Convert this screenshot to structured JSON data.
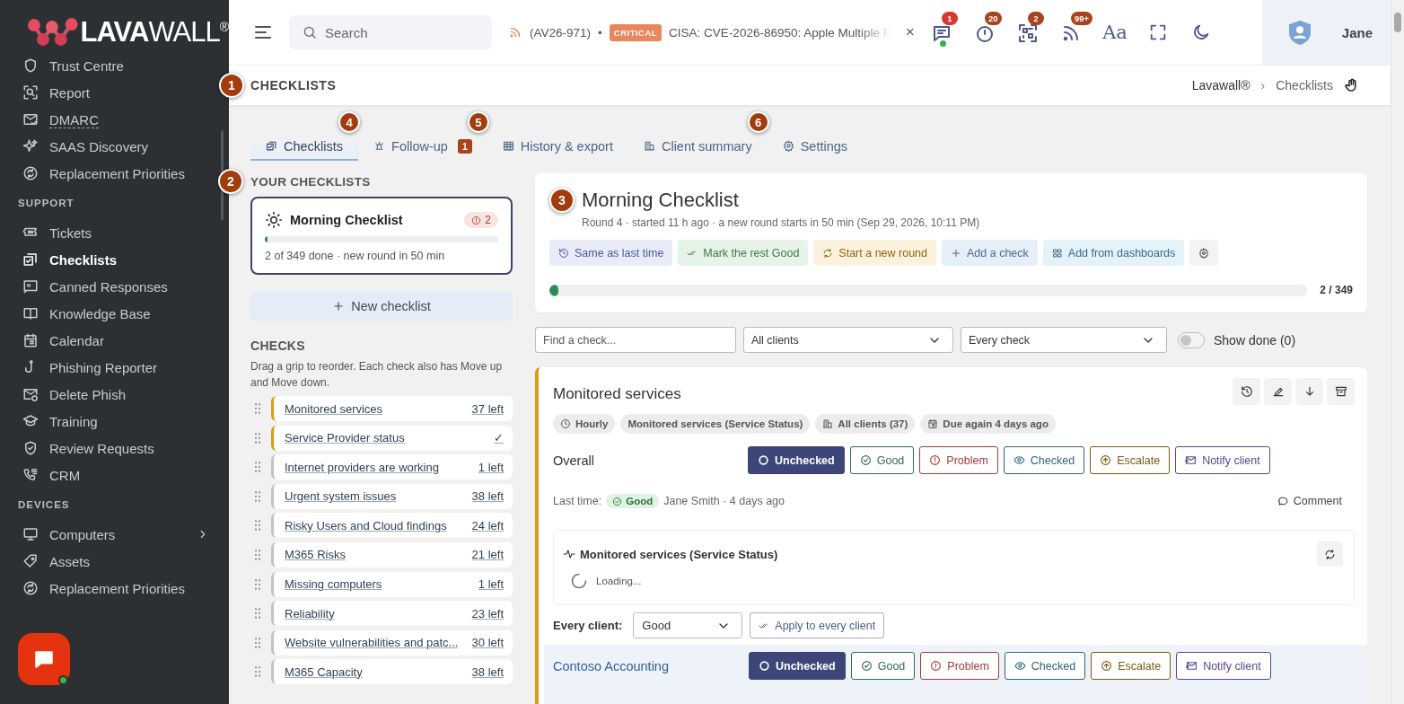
{
  "sidebar": {
    "logo_bold": "LAVA",
    "logo_light": "WALL",
    "logo_mark": "®",
    "items": [
      {
        "kind": "link",
        "label": "Trust Centre",
        "selected": false
      },
      {
        "kind": "link",
        "label": "Report",
        "selected": false
      },
      {
        "kind": "link",
        "label": "DMARC",
        "selected": false,
        "underlined": true
      },
      {
        "kind": "link",
        "label": "SAAS Discovery",
        "selected": false
      },
      {
        "kind": "link",
        "label": "Replacement Priorities",
        "selected": false
      },
      {
        "kind": "section",
        "label": "SUPPORT"
      },
      {
        "kind": "link",
        "label": "Tickets",
        "selected": false
      },
      {
        "kind": "link",
        "label": "Checklists",
        "selected": true
      },
      {
        "kind": "link",
        "label": "Canned Responses",
        "selected": false
      },
      {
        "kind": "link",
        "label": "Knowledge Base",
        "selected": false
      },
      {
        "kind": "link",
        "label": "Calendar",
        "selected": false
      },
      {
        "kind": "link",
        "label": "Phishing Reporter",
        "selected": false
      },
      {
        "kind": "link",
        "label": "Delete Phish",
        "selected": false
      },
      {
        "kind": "link",
        "label": "Training",
        "selected": false
      },
      {
        "kind": "link",
        "label": "Review Requests",
        "selected": false
      },
      {
        "kind": "link",
        "label": "CRM",
        "selected": false
      },
      {
        "kind": "section",
        "label": "DEVICES"
      },
      {
        "kind": "link",
        "label": "Computers",
        "selected": false,
        "expandable": true
      },
      {
        "kind": "link",
        "label": "Assets",
        "selected": false
      },
      {
        "kind": "link",
        "label": "Replacement Priorities",
        "selected": false
      }
    ],
    "chat": {
      "online": true
    }
  },
  "topbar": {
    "search": {
      "placeholder": "Search"
    },
    "ticker": {
      "prefix": "(AV26-971)",
      "separator": "•",
      "severity": "CRITICAL",
      "headline": "CISA: CVE-2026-86950: Apple Multiple P",
      "close": "×"
    },
    "notifications": [
      {
        "kind": "chat",
        "count": "1",
        "color": "#d63a2f",
        "online": true
      },
      {
        "kind": "timer",
        "count": "20",
        "color": "#a8431c"
      },
      {
        "kind": "qr",
        "count": "2",
        "color": "#a8431c"
      },
      {
        "kind": "feed",
        "count": "99+",
        "color": "#a8431c"
      }
    ],
    "font_button": "Aa",
    "user": "Jane"
  },
  "page_header": {
    "callout": "1",
    "title": "CHECKLISTS",
    "breadcrumb": [
      "Lavawall®",
      "Checklists"
    ],
    "breadcrumb_separator": "›"
  },
  "tabs": [
    {
      "label": "Checklists",
      "selected": true
    },
    {
      "label": "Follow-up",
      "selected": false,
      "badge": "1",
      "callout": "4"
    },
    {
      "label": "History & export",
      "selected": false,
      "callout": "5"
    },
    {
      "label": "Client summary",
      "selected": false
    },
    {
      "label": "Settings",
      "selected": false,
      "callout": "6"
    }
  ],
  "your_checklists": {
    "callout": "2",
    "heading": "YOUR CHECKLISTS",
    "items": [
      {
        "title": "Morning Checklist",
        "alerts": "2",
        "level": 0.006,
        "summary": "2 of 349 done · new round in 50 min",
        "selected": true
      }
    ],
    "new_button": "New checklist"
  },
  "checks": {
    "heading": "CHECKS",
    "help": "Drag a grip to reorder. Each check also has Move up and Move down.",
    "items": [
      {
        "name": "Monitored services",
        "remaining": "37 left",
        "color": "#d99a1e"
      },
      {
        "name": "Service Provider status",
        "remaining": "✓",
        "color": "#d99a1e"
      },
      {
        "name": "Internet providers are working",
        "remaining": "1 left",
        "color": "#c4c4c4"
      },
      {
        "name": "Urgent system issues",
        "remaining": "38 left",
        "color": "#c4c4c4"
      },
      {
        "name": "Risky Users and Cloud findings",
        "remaining": "24 left",
        "color": "#c4c4c4"
      },
      {
        "name": "M365 Risks",
        "remaining": "21 left",
        "color": "#c4c4c4"
      },
      {
        "name": "Missing computers",
        "remaining": "1 left",
        "color": "#c4c4c4"
      },
      {
        "name": "Reliability",
        "remaining": "23 left",
        "color": "#c4c4c4"
      },
      {
        "name": "Website vulnerabilities and patc...",
        "remaining": "30 left",
        "color": "#c4c4c4"
      },
      {
        "name": "M365 Capacity",
        "remaining": "38 left",
        "color": "#c4c4c4"
      }
    ]
  },
  "run": {
    "callout": "3",
    "title": "Morning Checklist",
    "subtitle": "Round 4 · started 11 h ago · a new round starts in 50 min (Sep 29, 2026, 10:11 PM)",
    "actions": [
      {
        "kind": "history",
        "label": "Same as last time"
      },
      {
        "kind": "good",
        "label": "Mark the rest Good"
      },
      {
        "kind": "round",
        "label": "Start a new round"
      },
      {
        "kind": "add",
        "label": "Add a check"
      },
      {
        "kind": "dashboards",
        "label": "Add from dashboards"
      },
      {
        "kind": "settings"
      }
    ],
    "level": 0.006,
    "reading": "2 / 349"
  },
  "filters": {
    "find": {
      "placeholder": "Find a check..."
    },
    "clients": "All clients",
    "scope": "Every check",
    "show_done": {
      "on": false,
      "label": "Show done (0)"
    }
  },
  "check": {
    "title": "Monitored services",
    "color": "#d99a1e",
    "chips": [
      {
        "kind": "schedule",
        "label": "Hourly"
      },
      {
        "kind": "source",
        "label": "Monitored services (Service Status)"
      },
      {
        "kind": "clients",
        "label": "All clients (37)"
      },
      {
        "kind": "due",
        "label": "Due again 4 days ago"
      }
    ],
    "overall": {
      "label": "Overall",
      "statuses": [
        {
          "kind": "unchecked",
          "label": "Unchecked",
          "selected": true
        },
        {
          "kind": "good",
          "label": "Good",
          "selected": false
        },
        {
          "kind": "problem",
          "label": "Problem",
          "selected": false
        },
        {
          "kind": "checked",
          "label": "Checked",
          "selected": false
        },
        {
          "kind": "escalate",
          "label": "Escalate",
          "selected": false
        },
        {
          "kind": "notify",
          "label": "Notify client",
          "selected": false
        }
      ]
    },
    "last_time": {
      "label": "Last time:",
      "status": "Good",
      "by": "Jane Smith · 4 days ago",
      "comment": "Comment"
    },
    "widget": {
      "title": "Monitored services (Service Status)",
      "loading": "Loading..."
    },
    "every_client": {
      "label": "Every client:",
      "value": "Good",
      "apply": "Apply to every client"
    },
    "clients": [
      {
        "name": "Contoso Accounting",
        "statuses": [
          {
            "kind": "unchecked",
            "label": "Unchecked",
            "selected": true
          },
          {
            "kind": "good",
            "label": "Good",
            "selected": false
          },
          {
            "kind": "problem",
            "label": "Problem",
            "selected": false
          },
          {
            "kind": "checked",
            "label": "Checked",
            "selected": false
          },
          {
            "kind": "escalate",
            "label": "Escalate",
            "selected": false
          },
          {
            "kind": "notify",
            "label": "Notify client",
            "selected": false
          }
        ]
      }
    ]
  }
}
